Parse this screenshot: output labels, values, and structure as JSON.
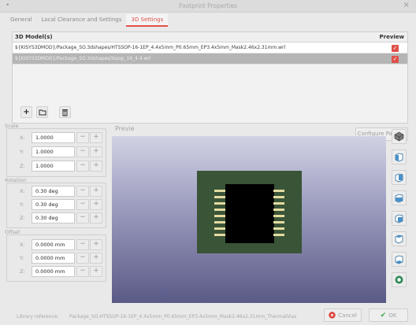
{
  "window": {
    "title": "Footprint Properties"
  },
  "tabs": [
    {
      "label": "General"
    },
    {
      "label": "Local Clearance and Settings"
    },
    {
      "label": "3D Settings"
    }
  ],
  "models": {
    "header_model": "3D Model(s)",
    "header_preview": "Preview",
    "rows": [
      {
        "path": "${KISYS3DMOD}/Package_SO.3dshapes/HTSSOP-16-1EP_4.4x5mm_P0.65mm_EP3.4x5mm_Mask2.46x2.31mm.wrl",
        "checked": true
      },
      {
        "path": "${KISYS3DMOD}/Package_SO.3dshapes/tssop_16_4.4.wrl",
        "checked": true
      }
    ]
  },
  "toolbar": {
    "add_icon": "plus-icon",
    "folder_icon": "folder-icon",
    "delete_icon": "trash-icon",
    "configure_paths": "Configure Paths..."
  },
  "scale": {
    "label": "Scale",
    "x_label": "X:",
    "x": "1.0000",
    "y_label": "Y:",
    "y": "1.0000",
    "z_label": "Z:",
    "z": "1.0000"
  },
  "rotation": {
    "label": "Rotation",
    "x_label": "X:",
    "x": "0.30 deg",
    "y_label": "Y:",
    "y": "0.30 deg",
    "z_label": "Z:",
    "z": "0.30 deg"
  },
  "offset": {
    "label": "Offset",
    "x_label": "X:",
    "x": "0.0000 mm",
    "y_label": "Y:",
    "y": "0.0000 mm",
    "z_label": "Z:",
    "z": "0.0000 mm"
  },
  "stepper": {
    "minus": "−",
    "plus": "+"
  },
  "preview": {
    "label": "Previe"
  },
  "footer": {
    "library_label": "Library reference:",
    "library_value": "Package_SO:HTSSOP-16-1EP_4.4x5mm_P0.65mm_EP3.4x5mm_Mask2.46x2.31mm_ThermalVias",
    "cancel": "Cancel",
    "ok": "OK"
  },
  "colors": {
    "accent": "#e0504a",
    "pcb": "#3a5438",
    "pad": "#e4dba0"
  }
}
